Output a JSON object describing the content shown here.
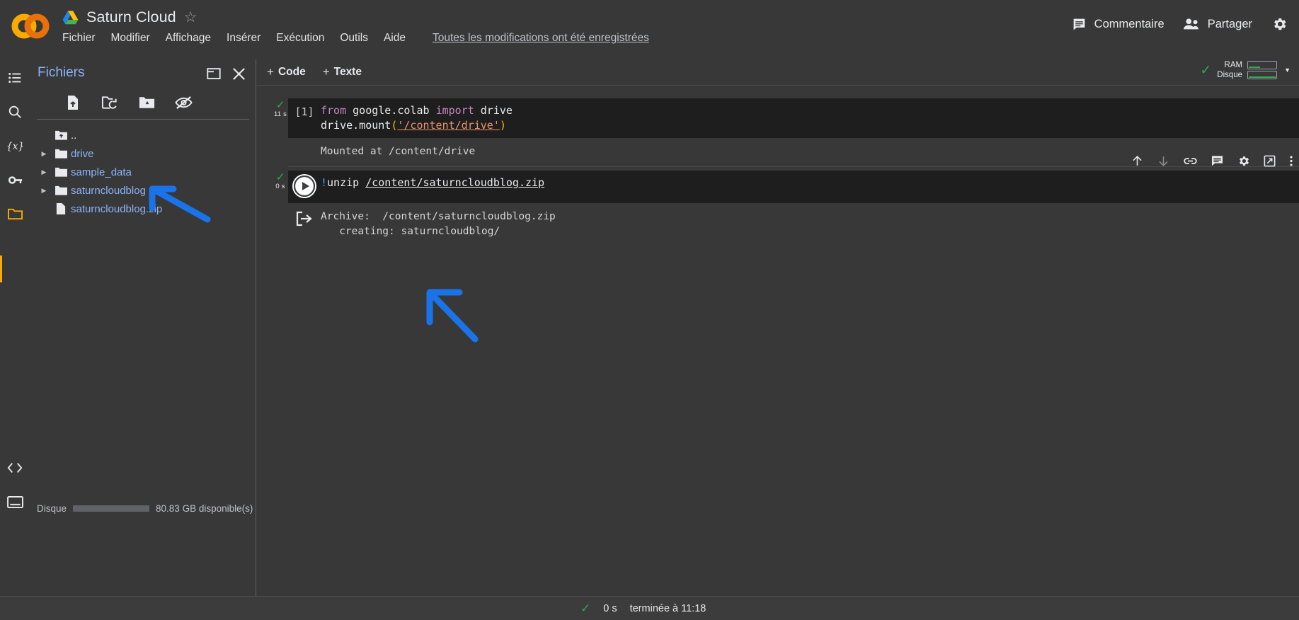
{
  "header": {
    "logo": "colab-logo",
    "drive_icon": "google-drive-icon",
    "doc_title": "Saturn Cloud",
    "star_icon": "star-outline-icon",
    "menu": [
      {
        "label": "Fichier"
      },
      {
        "label": "Modifier"
      },
      {
        "label": "Affichage"
      },
      {
        "label": "Insérer"
      },
      {
        "label": "Exécution"
      },
      {
        "label": "Outils"
      },
      {
        "label": "Aide"
      }
    ],
    "save_state": "Toutes les modifications ont été enregistrées",
    "comment_label": "Commentaire",
    "comment_icon": "comment-icon",
    "share_label": "Partager",
    "share_icon": "people-icon",
    "settings_icon": "gear-icon"
  },
  "rail": {
    "items": [
      {
        "icon": "table-of-contents-icon",
        "name": "sidebar-rail-toc"
      },
      {
        "icon": "search-icon",
        "name": "sidebar-rail-search"
      },
      {
        "icon": "variables-icon",
        "name": "sidebar-rail-variables"
      },
      {
        "icon": "key-icon",
        "name": "sidebar-rail-secrets"
      },
      {
        "icon": "folder-icon",
        "name": "sidebar-rail-files"
      },
      {
        "icon": "code-snippets-icon",
        "name": "sidebar-rail-snippets"
      },
      {
        "icon": "terminal-icon",
        "name": "sidebar-rail-terminal"
      }
    ]
  },
  "files_panel": {
    "title": "Fichiers",
    "restore_icon": "restore-panel-icon",
    "close_icon": "close-icon",
    "tools": [
      {
        "icon": "upload-file-icon",
        "name": "upload-file-button"
      },
      {
        "icon": "refresh-folder-icon",
        "name": "refresh-folder-button"
      },
      {
        "icon": "mount-drive-icon",
        "name": "mount-drive-button"
      },
      {
        "icon": "hide-hidden-files-icon",
        "name": "toggle-hidden-files-button"
      }
    ],
    "entries": [
      {
        "name": "..",
        "type": "parent",
        "icon": "folder-up-icon",
        "expandable": false
      },
      {
        "name": "drive",
        "type": "folder",
        "icon": "folder-icon",
        "expandable": true
      },
      {
        "name": "sample_data",
        "type": "folder",
        "icon": "folder-icon",
        "expandable": true
      },
      {
        "name": "saturncloudblog",
        "type": "folder",
        "icon": "folder-icon",
        "expandable": true
      },
      {
        "name": "saturncloudblog.zip",
        "type": "file",
        "icon": "file-icon",
        "expandable": false
      }
    ],
    "disk_label": "Disque",
    "disk_available": "80.83 GB disponible(s)",
    "disk_used_percent": 26
  },
  "notebook": {
    "toolbar": {
      "add_code_label": "Code",
      "add_text_label": "Texte",
      "plus": "+"
    },
    "resources": {
      "check_icon": "check-icon",
      "ram_label": "RAM",
      "disk_label": "Disque",
      "ram_fill_percent": 40,
      "disk_fill_percent": 95,
      "caret_icon": "chevron-down-icon"
    },
    "cells": [
      {
        "exec_count": "[1]",
        "runtime": "11 s",
        "status_icon": "check-icon",
        "code_lines": [
          [
            {
              "t": "from ",
              "c": "kw"
            },
            {
              "t": "google.colab ",
              "c": ""
            },
            {
              "t": "import ",
              "c": "kw"
            },
            {
              "t": "drive",
              "c": ""
            }
          ],
          [
            {
              "t": "drive.mount",
              "c": ""
            },
            {
              "t": "(",
              "c": "q"
            },
            {
              "t": "'",
              "c": "str"
            },
            {
              "t": "/content/drive",
              "c": "str"
            },
            {
              "t": "'",
              "c": "str"
            },
            {
              "t": ")",
              "c": "q"
            }
          ]
        ],
        "output_icon": null,
        "output_lines": [
          "Mounted at /content/drive"
        ]
      },
      {
        "exec_count": "",
        "runtime": "0 s",
        "status_icon": "check-icon",
        "run_icon": "play-icon",
        "code_lines": [
          [
            {
              "t": "!",
              "c": "bang"
            },
            {
              "t": "unzip ",
              "c": ""
            },
            {
              "t": "/content/saturncloudblog.zip",
              "c": "under"
            }
          ]
        ],
        "output_icon": "output-arrow-icon",
        "output_lines": [
          "Archive:  /content/saturncloudblog.zip",
          "   creating: saturncloudblog/"
        ]
      }
    ],
    "cell_toolbar_icons": [
      {
        "icon": "move-cell-up-icon",
        "name": "move-cell-up-button"
      },
      {
        "icon": "move-cell-down-icon",
        "name": "move-cell-down-button"
      },
      {
        "icon": "link-icon",
        "name": "copy-cell-link-button"
      },
      {
        "icon": "comment-icon",
        "name": "add-comment-button"
      },
      {
        "icon": "gear-icon",
        "name": "cell-settings-button"
      },
      {
        "icon": "popout-icon",
        "name": "mirror-cell-button"
      },
      {
        "icon": "more-vertical-icon",
        "name": "cell-more-button"
      }
    ]
  },
  "annotations": [
    {
      "name": "arrow-to-saturncloudblog-folder",
      "color": "#1a73e8"
    },
    {
      "name": "arrow-to-unzip-output",
      "color": "#1a73e8"
    }
  ],
  "statusbar": {
    "check_icon": "check-icon",
    "duration": "0 s",
    "finished": "terminée à 11:18"
  },
  "colors": {
    "accent_blue": "#8ab4f8",
    "annotation_blue": "#1a73e8",
    "success_green": "#34a853",
    "orange": "#f9ab00",
    "background": "#383838",
    "code_background": "#1e1e1e"
  }
}
